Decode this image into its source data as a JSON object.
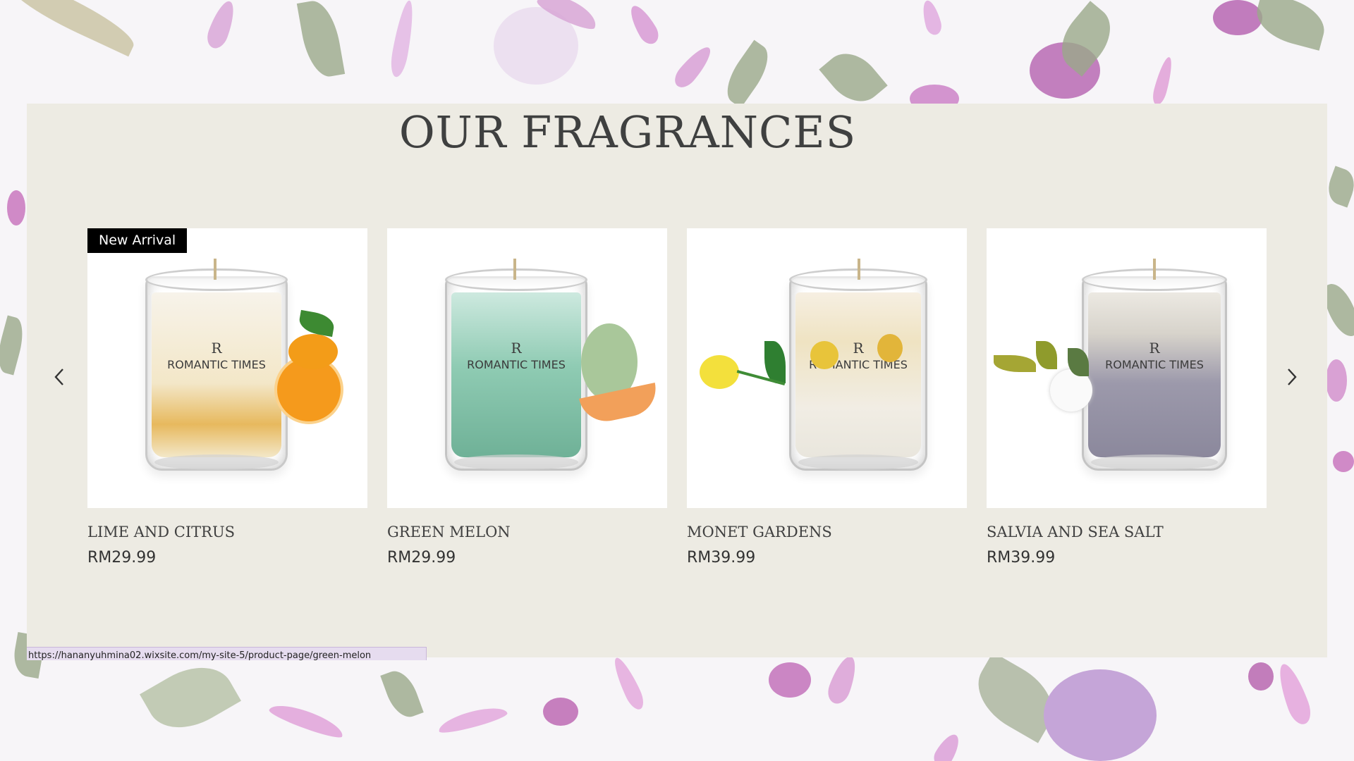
{
  "section": {
    "title": "OUR FRAGRANCES"
  },
  "carousel": {
    "prev_icon": "chevron-left-icon",
    "next_icon": "chevron-right-icon",
    "products": [
      {
        "name": "LIME AND CITRUS",
        "price": "RM29.99",
        "badge": "New Arrival",
        "label_mark": "R",
        "label_text": "ROMANTIC TIMES",
        "wax_color": "#f3e7c8",
        "accent_color": "#f59a1c",
        "decor": "orange"
      },
      {
        "name": "GREEN MELON",
        "price": "RM29.99",
        "badge": "",
        "label_mark": "R",
        "label_text": "ROMANTIC TIMES",
        "wax_color": "#8fcbb3",
        "accent_color": "#f2a05a",
        "decor": "melon"
      },
      {
        "name": "MONET GARDENS",
        "price": "RM39.99",
        "badge": "",
        "label_mark": "R",
        "label_text": "ROMANTIC TIMES",
        "wax_color": "#f1ede4",
        "accent_color": "#e8c43a",
        "decor": "yellow-rose"
      },
      {
        "name": "SALVIA AND SEA SALT",
        "price": "RM39.99",
        "badge": "",
        "label_mark": "R",
        "label_text": "ROMANTIC TIMES",
        "wax_color": "#9c99ab",
        "accent_color": "#ffffff",
        "decor": "white-flower"
      }
    ]
  },
  "status_bar": {
    "url": "https://hananyuhmina02.wixsite.com/my-site-5/product-page/green-melon"
  },
  "colors": {
    "panel_bg": "#edebe3",
    "title": "#3f4040",
    "badge_bg": "#000000"
  }
}
